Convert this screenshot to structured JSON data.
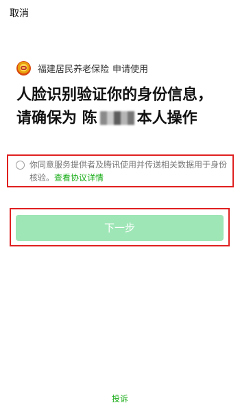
{
  "header": {
    "cancel_label": "取消"
  },
  "app": {
    "name": "福建居民养老保险",
    "request_label": "申请使用"
  },
  "headline": {
    "line1": "人脸识别验证你的身份信息，",
    "line2_prefix": "请确保为 陈",
    "line2_suffix": "本人操作"
  },
  "consent": {
    "text": "你同意服务提供者及腾讯使用并传送相关数据用于身份核验。",
    "link_label": "查看协议详情",
    "checked": false
  },
  "next_button": {
    "label": "下一步",
    "enabled": false
  },
  "footer": {
    "complain_label": "投诉"
  },
  "colors": {
    "accent_green": "#1aad19",
    "button_disabled_green": "#9ee6b6",
    "highlight_red": "#e01f1f"
  }
}
